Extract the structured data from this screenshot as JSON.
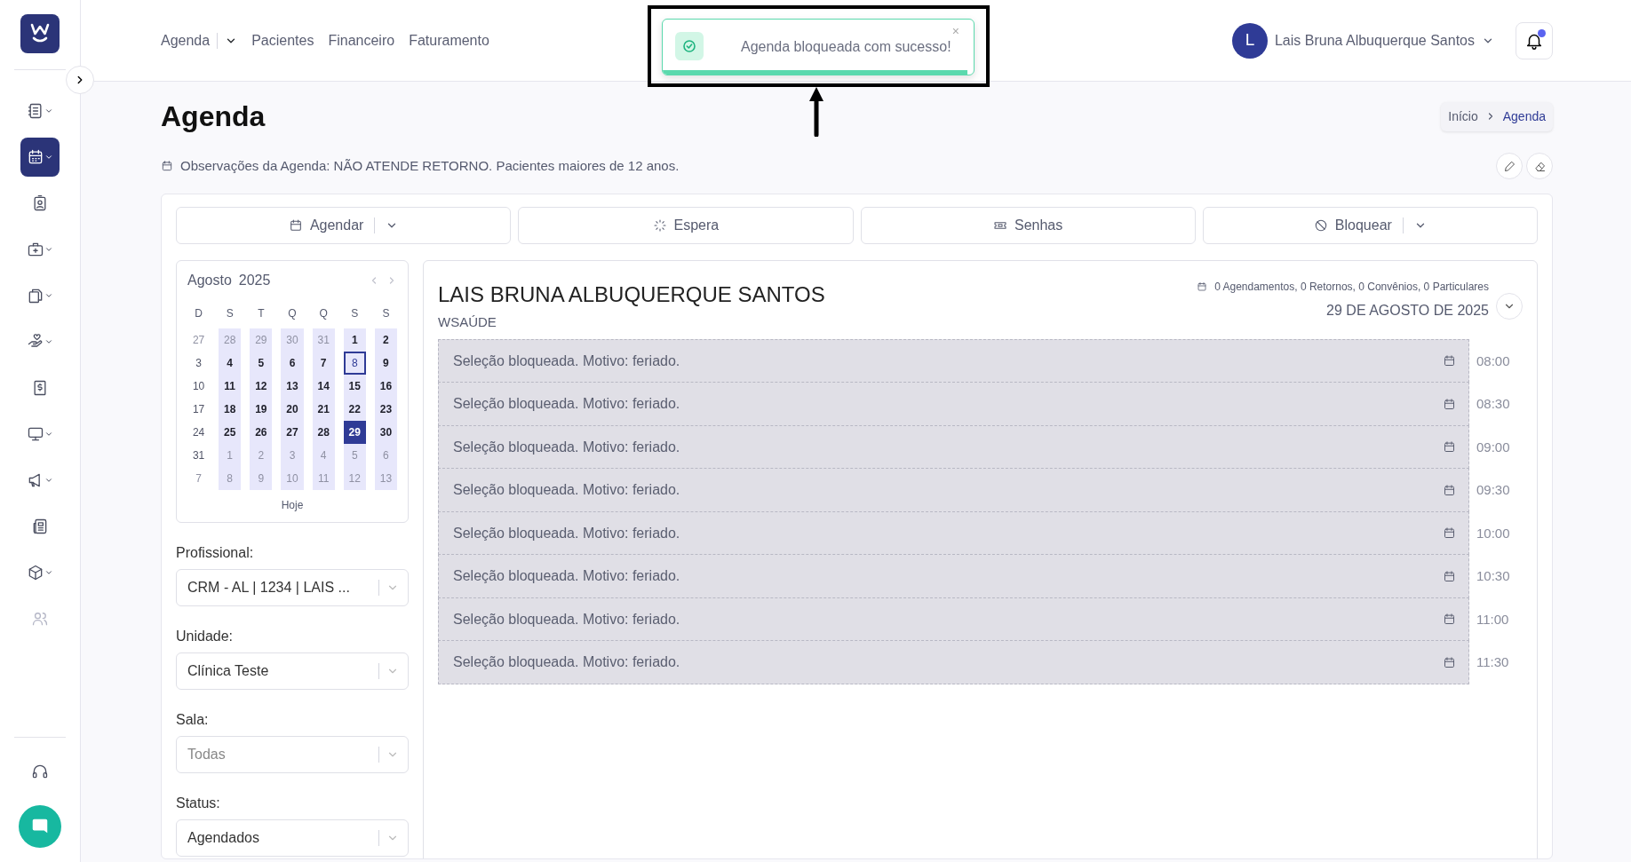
{
  "sidebar": {
    "items": [
      {
        "submenu": true,
        "selected": false,
        "disabled": false
      },
      {
        "submenu": true,
        "selected": true,
        "disabled": false
      },
      {
        "submenu": false,
        "selected": false,
        "disabled": false
      },
      {
        "submenu": true,
        "selected": false,
        "disabled": false
      },
      {
        "submenu": true,
        "selected": false,
        "disabled": false
      },
      {
        "submenu": true,
        "selected": false,
        "disabled": false
      },
      {
        "submenu": false,
        "selected": false,
        "disabled": false
      },
      {
        "submenu": true,
        "selected": false,
        "disabled": false
      },
      {
        "submenu": true,
        "selected": false,
        "disabled": false
      },
      {
        "submenu": false,
        "selected": false,
        "disabled": false
      },
      {
        "submenu": true,
        "selected": false,
        "disabled": false
      },
      {
        "submenu": false,
        "selected": false,
        "disabled": true
      }
    ]
  },
  "topnav": {
    "items": [
      {
        "label": "Agenda",
        "dropdown": true
      },
      {
        "label": "Pacientes",
        "dropdown": false
      },
      {
        "label": "Financeiro",
        "dropdown": false
      },
      {
        "label": "Faturamento",
        "dropdown": false
      }
    ]
  },
  "toast": {
    "message": "Agenda bloqueada com sucesso!",
    "close": "×",
    "level": 0.98
  },
  "user": {
    "initial": "L",
    "name": "Lais Bruna Albuquerque Santos",
    "notifications": true
  },
  "page": {
    "title": "Agenda",
    "breadcrumb": [
      {
        "label": "Início",
        "selected": false
      },
      {
        "label": "Agenda",
        "selected": true
      }
    ],
    "note": "Observações da Agenda: NÃO ATENDE RETORNO. Pacientes maiores de 12 anos."
  },
  "actions": [
    {
      "label": "Agendar",
      "dropdown": true
    },
    {
      "label": "Espera",
      "dropdown": false
    },
    {
      "label": "Senhas",
      "dropdown": false
    },
    {
      "label": "Bloquear",
      "dropdown": true
    }
  ],
  "calendar": {
    "month": "Agosto",
    "year": "2025",
    "weekdays": [
      "D",
      "S",
      "T",
      "Q",
      "Q",
      "S",
      "S"
    ],
    "today_label": "Hoje",
    "weeks": [
      [
        {
          "day": "27",
          "outside": true,
          "available": false,
          "selected": false,
          "today": false
        },
        {
          "day": "28",
          "outside": true,
          "available": true,
          "selected": false,
          "today": false
        },
        {
          "day": "29",
          "outside": true,
          "available": true,
          "selected": false,
          "today": false
        },
        {
          "day": "30",
          "outside": true,
          "available": true,
          "selected": false,
          "today": false
        },
        {
          "day": "31",
          "outside": true,
          "available": true,
          "selected": false,
          "today": false
        },
        {
          "day": "1",
          "outside": false,
          "available": true,
          "selected": false,
          "today": false
        },
        {
          "day": "2",
          "outside": false,
          "available": true,
          "selected": false,
          "today": false
        }
      ],
      [
        {
          "day": "3",
          "outside": false,
          "available": false,
          "selected": false,
          "today": false
        },
        {
          "day": "4",
          "outside": false,
          "available": true,
          "selected": false,
          "today": false
        },
        {
          "day": "5",
          "outside": false,
          "available": true,
          "selected": false,
          "today": false
        },
        {
          "day": "6",
          "outside": false,
          "available": true,
          "selected": false,
          "today": false
        },
        {
          "day": "7",
          "outside": false,
          "available": true,
          "selected": false,
          "today": false
        },
        {
          "day": "8",
          "outside": false,
          "available": true,
          "selected": false,
          "today": true
        },
        {
          "day": "9",
          "outside": false,
          "available": true,
          "selected": false,
          "today": false
        }
      ],
      [
        {
          "day": "10",
          "outside": false,
          "available": false,
          "selected": false,
          "today": false
        },
        {
          "day": "11",
          "outside": false,
          "available": true,
          "selected": false,
          "today": false
        },
        {
          "day": "12",
          "outside": false,
          "available": true,
          "selected": false,
          "today": false
        },
        {
          "day": "13",
          "outside": false,
          "available": true,
          "selected": false,
          "today": false
        },
        {
          "day": "14",
          "outside": false,
          "available": true,
          "selected": false,
          "today": false
        },
        {
          "day": "15",
          "outside": false,
          "available": true,
          "selected": false,
          "today": false
        },
        {
          "day": "16",
          "outside": false,
          "available": true,
          "selected": false,
          "today": false
        }
      ],
      [
        {
          "day": "17",
          "outside": false,
          "available": false,
          "selected": false,
          "today": false
        },
        {
          "day": "18",
          "outside": false,
          "available": true,
          "selected": false,
          "today": false
        },
        {
          "day": "19",
          "outside": false,
          "available": true,
          "selected": false,
          "today": false
        },
        {
          "day": "20",
          "outside": false,
          "available": true,
          "selected": false,
          "today": false
        },
        {
          "day": "21",
          "outside": false,
          "available": true,
          "selected": false,
          "today": false
        },
        {
          "day": "22",
          "outside": false,
          "available": true,
          "selected": false,
          "today": false
        },
        {
          "day": "23",
          "outside": false,
          "available": true,
          "selected": false,
          "today": false
        }
      ],
      [
        {
          "day": "24",
          "outside": false,
          "available": false,
          "selected": false,
          "today": false
        },
        {
          "day": "25",
          "outside": false,
          "available": true,
          "selected": false,
          "today": false
        },
        {
          "day": "26",
          "outside": false,
          "available": true,
          "selected": false,
          "today": false
        },
        {
          "day": "27",
          "outside": false,
          "available": true,
          "selected": false,
          "today": false
        },
        {
          "day": "28",
          "outside": false,
          "available": true,
          "selected": false,
          "today": false
        },
        {
          "day": "29",
          "outside": false,
          "available": true,
          "selected": true,
          "today": false
        },
        {
          "day": "30",
          "outside": false,
          "available": true,
          "selected": false,
          "today": false
        }
      ],
      [
        {
          "day": "31",
          "outside": false,
          "available": false,
          "selected": false,
          "today": false
        },
        {
          "day": "1",
          "outside": true,
          "available": true,
          "selected": false,
          "today": false
        },
        {
          "day": "2",
          "outside": true,
          "available": true,
          "selected": false,
          "today": false
        },
        {
          "day": "3",
          "outside": true,
          "available": true,
          "selected": false,
          "today": false
        },
        {
          "day": "4",
          "outside": true,
          "available": true,
          "selected": false,
          "today": false
        },
        {
          "day": "5",
          "outside": true,
          "available": true,
          "selected": false,
          "today": false
        },
        {
          "day": "6",
          "outside": true,
          "available": true,
          "selected": false,
          "today": false
        }
      ],
      [
        {
          "day": "7",
          "outside": true,
          "available": false,
          "selected": false,
          "today": false
        },
        {
          "day": "8",
          "outside": true,
          "available": true,
          "selected": false,
          "today": false
        },
        {
          "day": "9",
          "outside": true,
          "available": true,
          "selected": false,
          "today": false
        },
        {
          "day": "10",
          "outside": true,
          "available": true,
          "selected": false,
          "today": false
        },
        {
          "day": "11",
          "outside": true,
          "available": true,
          "selected": false,
          "today": false
        },
        {
          "day": "12",
          "outside": true,
          "available": true,
          "selected": false,
          "today": false
        },
        {
          "day": "13",
          "outside": true,
          "available": true,
          "selected": false,
          "today": false
        }
      ]
    ]
  },
  "filters": [
    {
      "label": "Profissional:",
      "value": "CRM - AL | 1234 | LAIS ..."
    },
    {
      "label": "Unidade:",
      "value": "Clínica Teste"
    },
    {
      "label": "Sala:",
      "placeholder": "Todas"
    },
    {
      "label": "Status:",
      "value": "Agendados"
    }
  ],
  "schedule": {
    "professional": "LAIS BRUNA ALBUQUERQUE SANTOS",
    "organization": "WSAÚDE",
    "summary": "0 Agendamentos, 0 Retornos, 0 Convênios, 0 Particulares",
    "date": "29 DE AGOSTO DE 2025",
    "slots": [
      {
        "text": "Seleção bloqueada. Motivo: feriado.",
        "time": "08:00",
        "blocked": true
      },
      {
        "text": "Seleção bloqueada. Motivo: feriado.",
        "time": "08:30",
        "blocked": true
      },
      {
        "text": "Seleção bloqueada. Motivo: feriado.",
        "time": "09:00",
        "blocked": true
      },
      {
        "text": "Seleção bloqueada. Motivo: feriado.",
        "time": "09:30",
        "blocked": true
      },
      {
        "text": "Seleção bloqueada. Motivo: feriado.",
        "time": "10:00",
        "blocked": true
      },
      {
        "text": "Seleção bloqueada. Motivo: feriado.",
        "time": "10:30",
        "blocked": true
      },
      {
        "text": "Seleção bloqueada. Motivo: feriado.",
        "time": "11:00",
        "blocked": true
      },
      {
        "text": "Seleção bloqueada. Motivo: feriado.",
        "time": "11:30",
        "blocked": true
      }
    ]
  }
}
